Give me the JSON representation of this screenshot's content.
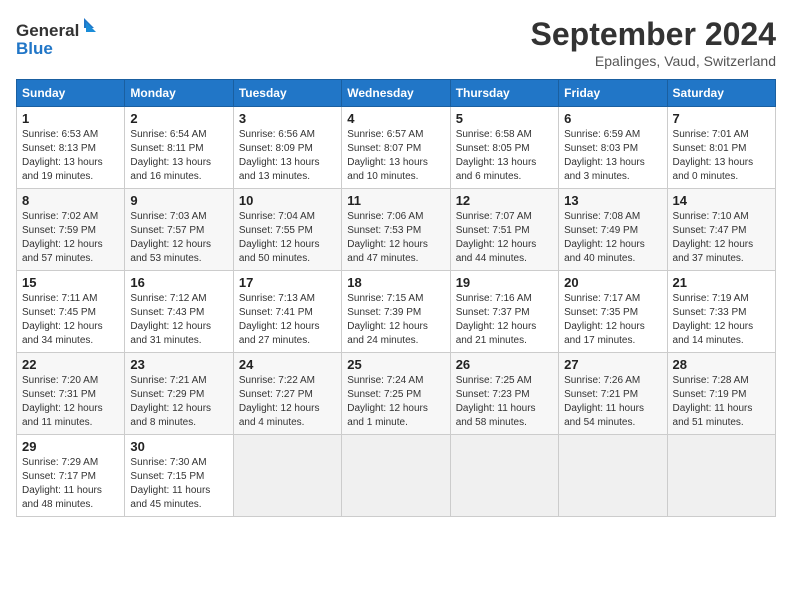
{
  "header": {
    "logo_line1": "General",
    "logo_line2": "Blue",
    "month": "September 2024",
    "location": "Epalinges, Vaud, Switzerland"
  },
  "weekdays": [
    "Sunday",
    "Monday",
    "Tuesday",
    "Wednesday",
    "Thursday",
    "Friday",
    "Saturday"
  ],
  "weeks": [
    [
      {
        "day": "1",
        "info": "Sunrise: 6:53 AM\nSunset: 8:13 PM\nDaylight: 13 hours\nand 19 minutes."
      },
      {
        "day": "2",
        "info": "Sunrise: 6:54 AM\nSunset: 8:11 PM\nDaylight: 13 hours\nand 16 minutes."
      },
      {
        "day": "3",
        "info": "Sunrise: 6:56 AM\nSunset: 8:09 PM\nDaylight: 13 hours\nand 13 minutes."
      },
      {
        "day": "4",
        "info": "Sunrise: 6:57 AM\nSunset: 8:07 PM\nDaylight: 13 hours\nand 10 minutes."
      },
      {
        "day": "5",
        "info": "Sunrise: 6:58 AM\nSunset: 8:05 PM\nDaylight: 13 hours\nand 6 minutes."
      },
      {
        "day": "6",
        "info": "Sunrise: 6:59 AM\nSunset: 8:03 PM\nDaylight: 13 hours\nand 3 minutes."
      },
      {
        "day": "7",
        "info": "Sunrise: 7:01 AM\nSunset: 8:01 PM\nDaylight: 13 hours\nand 0 minutes."
      }
    ],
    [
      {
        "day": "8",
        "info": "Sunrise: 7:02 AM\nSunset: 7:59 PM\nDaylight: 12 hours\nand 57 minutes."
      },
      {
        "day": "9",
        "info": "Sunrise: 7:03 AM\nSunset: 7:57 PM\nDaylight: 12 hours\nand 53 minutes."
      },
      {
        "day": "10",
        "info": "Sunrise: 7:04 AM\nSunset: 7:55 PM\nDaylight: 12 hours\nand 50 minutes."
      },
      {
        "day": "11",
        "info": "Sunrise: 7:06 AM\nSunset: 7:53 PM\nDaylight: 12 hours\nand 47 minutes."
      },
      {
        "day": "12",
        "info": "Sunrise: 7:07 AM\nSunset: 7:51 PM\nDaylight: 12 hours\nand 44 minutes."
      },
      {
        "day": "13",
        "info": "Sunrise: 7:08 AM\nSunset: 7:49 PM\nDaylight: 12 hours\nand 40 minutes."
      },
      {
        "day": "14",
        "info": "Sunrise: 7:10 AM\nSunset: 7:47 PM\nDaylight: 12 hours\nand 37 minutes."
      }
    ],
    [
      {
        "day": "15",
        "info": "Sunrise: 7:11 AM\nSunset: 7:45 PM\nDaylight: 12 hours\nand 34 minutes."
      },
      {
        "day": "16",
        "info": "Sunrise: 7:12 AM\nSunset: 7:43 PM\nDaylight: 12 hours\nand 31 minutes."
      },
      {
        "day": "17",
        "info": "Sunrise: 7:13 AM\nSunset: 7:41 PM\nDaylight: 12 hours\nand 27 minutes."
      },
      {
        "day": "18",
        "info": "Sunrise: 7:15 AM\nSunset: 7:39 PM\nDaylight: 12 hours\nand 24 minutes."
      },
      {
        "day": "19",
        "info": "Sunrise: 7:16 AM\nSunset: 7:37 PM\nDaylight: 12 hours\nand 21 minutes."
      },
      {
        "day": "20",
        "info": "Sunrise: 7:17 AM\nSunset: 7:35 PM\nDaylight: 12 hours\nand 17 minutes."
      },
      {
        "day": "21",
        "info": "Sunrise: 7:19 AM\nSunset: 7:33 PM\nDaylight: 12 hours\nand 14 minutes."
      }
    ],
    [
      {
        "day": "22",
        "info": "Sunrise: 7:20 AM\nSunset: 7:31 PM\nDaylight: 12 hours\nand 11 minutes."
      },
      {
        "day": "23",
        "info": "Sunrise: 7:21 AM\nSunset: 7:29 PM\nDaylight: 12 hours\nand 8 minutes."
      },
      {
        "day": "24",
        "info": "Sunrise: 7:22 AM\nSunset: 7:27 PM\nDaylight: 12 hours\nand 4 minutes."
      },
      {
        "day": "25",
        "info": "Sunrise: 7:24 AM\nSunset: 7:25 PM\nDaylight: 12 hours\nand 1 minute."
      },
      {
        "day": "26",
        "info": "Sunrise: 7:25 AM\nSunset: 7:23 PM\nDaylight: 11 hours\nand 58 minutes."
      },
      {
        "day": "27",
        "info": "Sunrise: 7:26 AM\nSunset: 7:21 PM\nDaylight: 11 hours\nand 54 minutes."
      },
      {
        "day": "28",
        "info": "Sunrise: 7:28 AM\nSunset: 7:19 PM\nDaylight: 11 hours\nand 51 minutes."
      }
    ],
    [
      {
        "day": "29",
        "info": "Sunrise: 7:29 AM\nSunset: 7:17 PM\nDaylight: 11 hours\nand 48 minutes."
      },
      {
        "day": "30",
        "info": "Sunrise: 7:30 AM\nSunset: 7:15 PM\nDaylight: 11 hours\nand 45 minutes."
      },
      {
        "day": "",
        "info": ""
      },
      {
        "day": "",
        "info": ""
      },
      {
        "day": "",
        "info": ""
      },
      {
        "day": "",
        "info": ""
      },
      {
        "day": "",
        "info": ""
      }
    ]
  ]
}
